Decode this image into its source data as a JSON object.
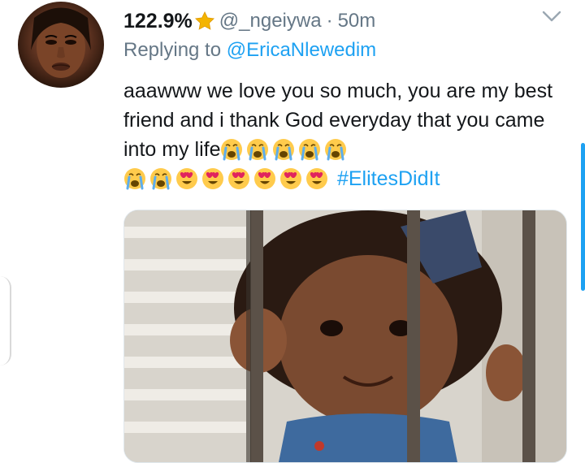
{
  "tweet": {
    "display_name": "122.9%",
    "badge_icon": "star-icon",
    "handle": "@_ngeiywa",
    "separator": "·",
    "time": "50m",
    "replying_prefix": "Replying to",
    "replying_to": "@EricaNlewedim",
    "text_part1": "aaawww we love you so much, you are my best friend and i thank God everyday that you came into my life",
    "hashtag": "#ElitesDidIt",
    "emojis": [
      "crying-face",
      "crying-face",
      "crying-face",
      "crying-face",
      "crying-face",
      "crying-face",
      "crying-face",
      "heart-eyes",
      "heart-eyes",
      "heart-eyes",
      "heart-eyes",
      "heart-eyes",
      "heart-eyes"
    ]
  },
  "colors": {
    "link": "#1da1f2",
    "secondary_text": "#657786",
    "primary_text": "#14171a"
  }
}
